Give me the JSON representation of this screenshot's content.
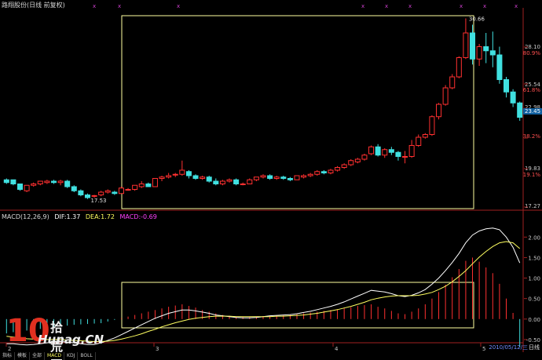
{
  "title": "路翔股份(日线 前复权)",
  "macd_header": {
    "name": "MACD(12,26,9)",
    "dif": "DIF:1.37",
    "dea": "DEA:1.72",
    "macd": "MACD:-0.69"
  },
  "colors": {
    "up": "#ff3030",
    "down": "#40e0e0",
    "dif": "#ffffff",
    "dea": "#ffff60",
    "box": "#ffffa0"
  },
  "price_axis": [
    "28.10",
    "80.9%",
    "25.54",
    "61.8%",
    "22.98",
    "38.2%",
    "19.83",
    "19.1%",
    "17.27"
  ],
  "macd_axis": [
    "2.00",
    "1.50",
    "1.00",
    "0.50",
    "0.00",
    "-0.50"
  ],
  "annotations": {
    "high": "30.66",
    "low": "17.53",
    "current": "23.45"
  },
  "x_ticks": [
    "2",
    "3",
    "4",
    "5"
  ],
  "date": "2010/05/12/三",
  "period": "日线",
  "tabs": [
    "指标",
    "模板",
    "全部",
    "MACD",
    "KDJ",
    "BOLL"
  ],
  "watermark": {
    "logo": "10",
    "cn": "拾荒网",
    "en": "Hunag.CN"
  },
  "chart_data": {
    "type": "candlestick",
    "candles": [
      [
        18.9,
        19.0,
        18.7,
        18.6
      ],
      [
        18.9,
        18.8,
        18.6,
        18.5
      ],
      [
        18.6,
        18.6,
        18.2,
        18.1
      ],
      [
        18.1,
        18.5,
        18.5,
        18.0
      ],
      [
        18.5,
        18.7,
        18.6,
        18.4
      ],
      [
        18.6,
        18.8,
        18.8,
        18.5
      ],
      [
        18.7,
        18.9,
        18.8,
        18.6
      ],
      [
        18.8,
        18.9,
        18.7,
        18.6
      ],
      [
        18.7,
        18.9,
        18.8,
        18.5
      ],
      [
        18.8,
        18.9,
        18.4,
        18.3
      ],
      [
        18.4,
        18.5,
        18.1,
        18.0
      ],
      [
        18.1,
        18.2,
        17.8,
        17.7
      ],
      [
        17.8,
        17.9,
        17.6,
        17.5
      ],
      [
        17.7,
        17.8,
        17.75,
        17.6
      ],
      [
        17.8,
        18.1,
        18.0,
        17.7
      ],
      [
        18.0,
        18.2,
        18.1,
        17.9
      ],
      [
        18.0,
        18.1,
        17.9,
        17.8
      ],
      [
        17.9,
        18.4,
        18.3,
        17.9
      ],
      [
        18.2,
        18.3,
        18.2,
        18.1
      ],
      [
        18.2,
        18.5,
        18.5,
        18.1
      ],
      [
        18.4,
        18.8,
        18.6,
        18.3
      ],
      [
        18.6,
        18.7,
        18.4,
        18.4
      ],
      [
        18.4,
        19.0,
        19.0,
        18.4
      ],
      [
        19.0,
        19.2,
        19.1,
        18.8
      ],
      [
        19.1,
        19.4,
        19.2,
        19.0
      ],
      [
        19.3,
        19.4,
        19.3,
        19.1
      ],
      [
        19.3,
        20.3,
        19.6,
        19.2
      ],
      [
        19.5,
        19.6,
        19.2,
        19.0
      ],
      [
        19.2,
        19.3,
        19.0,
        18.9
      ],
      [
        19.0,
        19.2,
        19.1,
        18.9
      ],
      [
        19.1,
        19.2,
        18.8,
        18.7
      ],
      [
        18.8,
        19.0,
        18.6,
        18.5
      ],
      [
        18.6,
        18.9,
        18.8,
        18.5
      ],
      [
        18.8,
        19.0,
        18.9,
        18.7
      ],
      [
        18.9,
        19.0,
        18.6,
        18.5
      ],
      [
        18.6,
        18.7,
        18.6,
        18.5
      ],
      [
        18.6,
        19.0,
        18.9,
        18.6
      ],
      [
        18.9,
        19.1,
        19.1,
        18.8
      ],
      [
        19.1,
        19.3,
        19.2,
        19.0
      ],
      [
        19.2,
        19.3,
        19.0,
        18.9
      ],
      [
        19.0,
        19.2,
        19.1,
        18.9
      ],
      [
        19.1,
        19.2,
        19.0,
        18.9
      ],
      [
        19.0,
        19.1,
        18.9,
        18.8
      ],
      [
        18.9,
        19.2,
        19.2,
        18.9
      ],
      [
        19.1,
        19.3,
        19.2,
        19.0
      ],
      [
        19.2,
        19.4,
        19.3,
        19.1
      ],
      [
        19.3,
        19.6,
        19.5,
        19.2
      ],
      [
        19.5,
        19.6,
        19.4,
        19.3
      ],
      [
        19.4,
        19.7,
        19.6,
        19.3
      ],
      [
        19.6,
        19.9,
        19.8,
        19.5
      ],
      [
        19.8,
        20.1,
        20.0,
        19.7
      ],
      [
        20.0,
        20.4,
        20.3,
        19.9
      ],
      [
        20.2,
        20.5,
        20.4,
        20.1
      ],
      [
        20.4,
        20.8,
        20.7,
        20.3
      ],
      [
        20.8,
        21.4,
        21.3,
        20.7
      ],
      [
        21.3,
        21.5,
        20.7,
        20.6
      ],
      [
        20.7,
        21.2,
        21.1,
        20.5
      ],
      [
        21.1,
        21.3,
        20.9,
        20.7
      ],
      [
        20.9,
        21.0,
        20.6,
        20.3
      ],
      [
        20.6,
        21.0,
        20.6,
        20.1
      ],
      [
        20.6,
        21.8,
        21.4,
        20.5
      ],
      [
        21.4,
        22.2,
        22.0,
        21.3
      ],
      [
        22.0,
        22.3,
        22.2,
        21.9
      ],
      [
        22.2,
        23.6,
        23.5,
        22.1
      ],
      [
        23.5,
        24.5,
        24.4,
        23.3
      ],
      [
        24.4,
        25.8,
        25.6,
        24.3
      ],
      [
        25.6,
        26.6,
        26.4,
        25.5
      ],
      [
        26.4,
        27.9,
        27.8,
        26.3
      ],
      [
        27.8,
        30.66,
        29.6,
        27.7
      ],
      [
        29.6,
        30.2,
        27.7,
        27.3
      ],
      [
        27.7,
        28.8,
        28.6,
        27.2
      ],
      [
        28.6,
        29.6,
        28.3,
        27.4
      ],
      [
        28.3,
        29.7,
        28.0,
        27.1
      ],
      [
        28.0,
        28.6,
        26.2,
        25.9
      ],
      [
        26.2,
        26.4,
        25.3,
        24.9
      ],
      [
        25.3,
        25.5,
        24.5,
        24.2
      ],
      [
        24.5,
        24.6,
        23.45,
        23.2
      ]
    ],
    "macd_hist": [
      -0.35,
      -0.32,
      -0.3,
      -0.28,
      -0.26,
      -0.24,
      -0.22,
      -0.2,
      -0.18,
      -0.16,
      -0.14,
      -0.13,
      -0.12,
      -0.11,
      -0.1,
      -0.06,
      -0.02,
      0.02,
      0.06,
      0.1,
      0.14,
      0.18,
      0.22,
      0.26,
      0.3,
      0.33,
      0.36,
      0.32,
      0.28,
      0.22,
      0.18,
      0.14,
      0.1,
      0.08,
      0.06,
      0.05,
      0.05,
      0.06,
      0.07,
      0.08,
      0.08,
      0.09,
      0.1,
      0.12,
      0.14,
      0.16,
      0.18,
      0.2,
      0.22,
      0.24,
      0.26,
      0.29,
      0.32,
      0.34,
      0.36,
      0.3,
      0.26,
      0.2,
      0.14,
      0.12,
      0.18,
      0.26,
      0.36,
      0.5,
      0.66,
      0.84,
      1.02,
      1.22,
      1.42,
      1.5,
      1.4,
      1.26,
      1.12,
      0.86,
      0.5,
      0.15,
      -0.69
    ],
    "dif": [
      -0.6,
      -0.6,
      -0.62,
      -0.63,
      -0.62,
      -0.6,
      -0.58,
      -0.56,
      -0.55,
      -0.56,
      -0.58,
      -0.6,
      -0.62,
      -0.62,
      -0.58,
      -0.52,
      -0.46,
      -0.38,
      -0.3,
      -0.22,
      -0.14,
      -0.06,
      0.02,
      0.08,
      0.14,
      0.18,
      0.22,
      0.22,
      0.2,
      0.17,
      0.14,
      0.1,
      0.08,
      0.06,
      0.04,
      0.03,
      0.03,
      0.04,
      0.06,
      0.08,
      0.09,
      0.1,
      0.11,
      0.13,
      0.16,
      0.19,
      0.23,
      0.27,
      0.31,
      0.36,
      0.42,
      0.49,
      0.56,
      0.63,
      0.7,
      0.68,
      0.66,
      0.62,
      0.57,
      0.55,
      0.58,
      0.64,
      0.72,
      0.85,
      1.0,
      1.18,
      1.38,
      1.6,
      1.86,
      2.05,
      2.15,
      2.2,
      2.22,
      2.18,
      2.0,
      1.75,
      1.37
    ],
    "dea": [
      -0.42,
      -0.44,
      -0.46,
      -0.48,
      -0.49,
      -0.5,
      -0.5,
      -0.5,
      -0.5,
      -0.51,
      -0.52,
      -0.53,
      -0.54,
      -0.55,
      -0.55,
      -0.54,
      -0.52,
      -0.49,
      -0.45,
      -0.41,
      -0.36,
      -0.3,
      -0.25,
      -0.19,
      -0.14,
      -0.09,
      -0.05,
      -0.01,
      0.02,
      0.04,
      0.06,
      0.07,
      0.07,
      0.07,
      0.06,
      0.06,
      0.06,
      0.06,
      0.06,
      0.06,
      0.07,
      0.07,
      0.08,
      0.09,
      0.1,
      0.12,
      0.14,
      0.17,
      0.2,
      0.23,
      0.27,
      0.31,
      0.36,
      0.41,
      0.47,
      0.51,
      0.54,
      0.56,
      0.57,
      0.57,
      0.57,
      0.58,
      0.61,
      0.65,
      0.72,
      0.8,
      0.91,
      1.04,
      1.18,
      1.35,
      1.51,
      1.65,
      1.77,
      1.86,
      1.89,
      1.86,
      1.72
    ],
    "price_range": [
      16.8,
      31.2
    ],
    "macd_range": [
      -0.75,
      2.35
    ]
  }
}
